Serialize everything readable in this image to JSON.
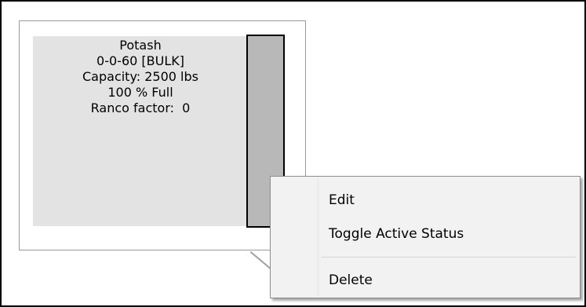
{
  "bin": {
    "product": "Potash",
    "analysis": "0-0-60 [BULK]",
    "capacity": "Capacity: 2500 lbs",
    "fill": "100 % Full",
    "ranco": "Ranco factor:  0",
    "fill_fraction": 1.0,
    "fill_color": "#b8b8b8"
  },
  "context_menu": {
    "items": [
      {
        "label": "Edit"
      },
      {
        "label": "Toggle Active Status"
      },
      {
        "label": "Delete"
      }
    ]
  }
}
